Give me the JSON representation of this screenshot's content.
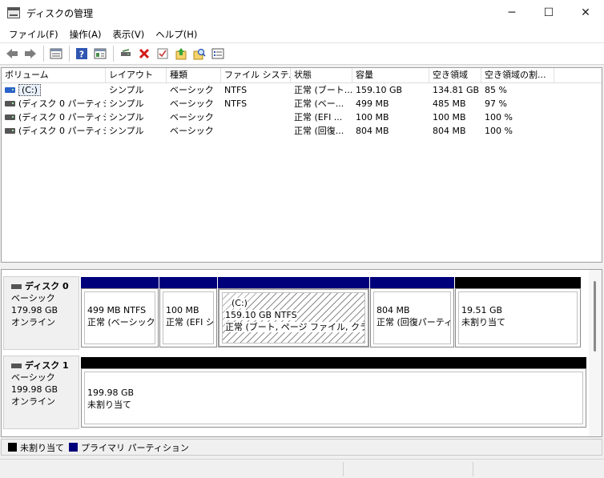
{
  "window": {
    "title": "ディスクの管理",
    "minimize": "─",
    "maximize": "☐",
    "close": "✕"
  },
  "menu": [
    "ファイル(F)",
    "操作(A)",
    "表示(V)",
    "ヘルプ(H)"
  ],
  "toolbar": [
    "back-icon",
    "forward-icon",
    "list-view-icon",
    "help-icon",
    "properties-icon",
    "connect-disk-icon",
    "delete-icon",
    "check-icon",
    "import-icon",
    "search-icon",
    "settings-list-icon"
  ],
  "volume_list": {
    "columns": [
      "ボリューム",
      "レイアウト",
      "種類",
      "ファイル システム",
      "状態",
      "容量",
      "空き領域",
      "空き領域の割..."
    ],
    "rows": [
      [
        "(C:)",
        "シンプル",
        "ベーシック",
        "NTFS",
        "正常 (ブート...",
        "159.10 GB",
        "134.81 GB",
        "85 %"
      ],
      [
        "(ディスク 0 パーティシ...",
        "シンプル",
        "ベーシック",
        "NTFS",
        "正常 (ベー...",
        "499 MB",
        "485 MB",
        "97 %"
      ],
      [
        "(ディスク 0 パーティシ...",
        "シンプル",
        "ベーシック",
        "",
        "正常 (EFI ...",
        "100 MB",
        "100 MB",
        "100 %"
      ],
      [
        "(ディスク 0 パーティシ...",
        "シンプル",
        "ベーシック",
        "",
        "正常 (回復...",
        "804 MB",
        "804 MB",
        "100 %"
      ]
    ]
  },
  "disks": [
    {
      "name": "ディスク 0",
      "type": "ベーシック",
      "size": "179.98 GB",
      "status": "オンライン",
      "partitions": [
        {
          "title": "",
          "size": "499 MB NTFS",
          "status": "正常 (ベーシック デ",
          "kind": "primary"
        },
        {
          "title": "",
          "size": "100 MB",
          "status": "正常 (EFI シ",
          "kind": "primary"
        },
        {
          "title": "(C:)",
          "size": "159.10 GB NTFS",
          "status": "正常 (ブート, ページ ファイル, クラッシュ",
          "kind": "primary"
        },
        {
          "title": "",
          "size": "804 MB",
          "status": "正常 (回復パーティ",
          "kind": "primary"
        },
        {
          "title": "",
          "size": "19.51 GB",
          "status": "未割り当て",
          "kind": "unalloc"
        }
      ]
    },
    {
      "name": "ディスク 1",
      "type": "ベーシック",
      "size": "199.98 GB",
      "status": "オンライン",
      "partitions": [
        {
          "title": "",
          "size": "199.98 GB",
          "status": "未割り当て",
          "kind": "unalloc"
        }
      ]
    }
  ],
  "legend": {
    "unallocated": "未割り当て",
    "primary": "プライマリ パーティション",
    "unallocated_color": "#000000",
    "primary_color": "#00007b"
  }
}
